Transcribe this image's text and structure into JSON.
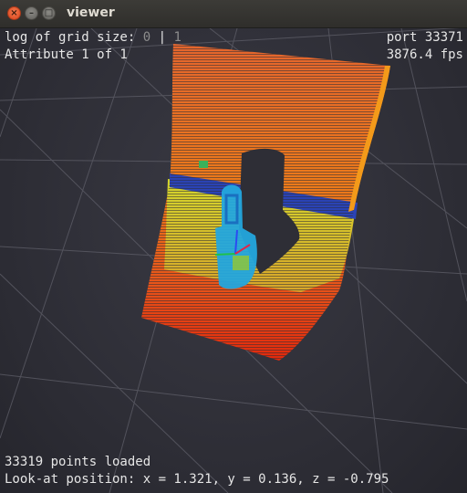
{
  "window": {
    "title": "viewer"
  },
  "titlebar_buttons": {
    "close": "×",
    "minimize": "–",
    "maximize": "□"
  },
  "hud": {
    "grid_label": "log of grid size:",
    "grid_option_a": "0",
    "grid_sep": "|",
    "grid_option_b": "1",
    "attribute": "Attribute 1 of 1",
    "port": "port 33371",
    "fps": "3876.4 fps",
    "points": "33319 points loaded",
    "lookat": "Look-at position: x = 1.321, y = 0.136, z = -0.795"
  },
  "colors": {
    "background": "#2e2e36",
    "grid": "#5a5a63",
    "near": "#e52a0a",
    "mid": "#f07a15",
    "far": "#e0672c",
    "band_yellow": "#c9cf2f",
    "band_blue": "#2440b8",
    "object_cyan": "#27b2e8"
  }
}
